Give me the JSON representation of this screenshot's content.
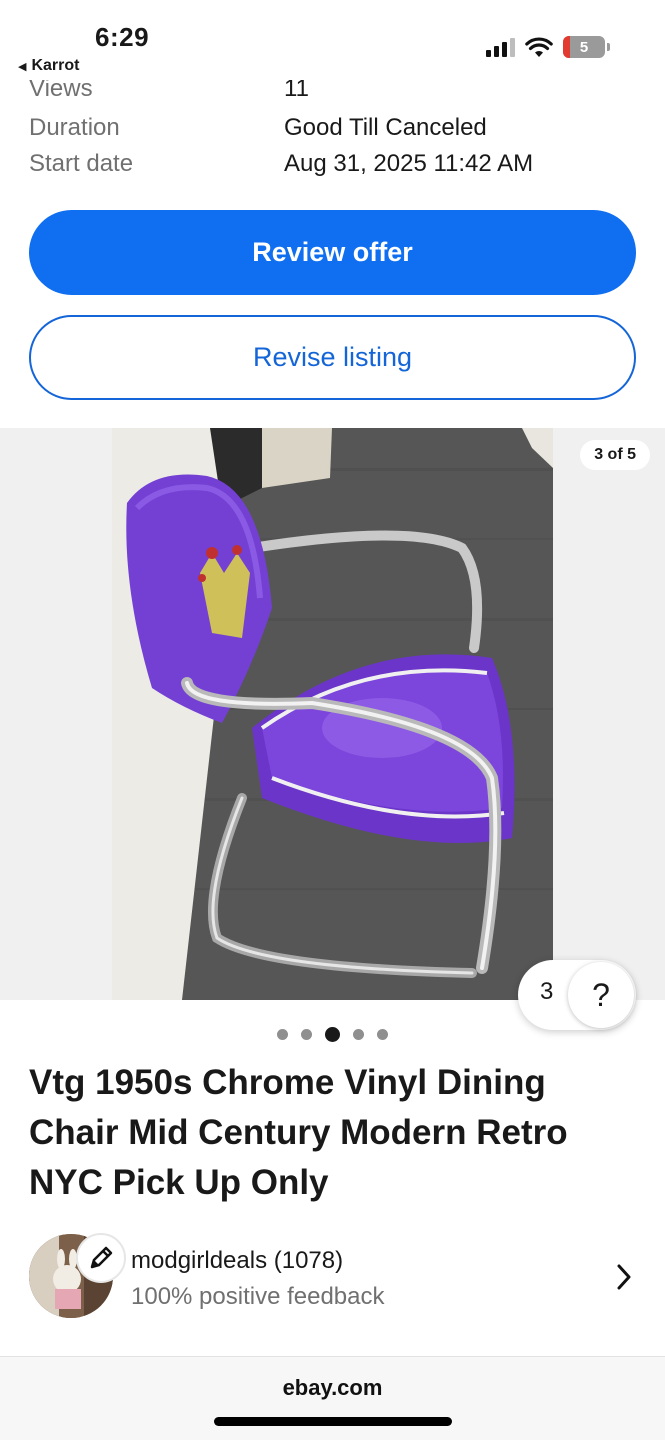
{
  "status_bar": {
    "time": "6:29",
    "back_app": "Karrot",
    "battery_level": "5"
  },
  "details": {
    "partial_row": {
      "label": "Views",
      "value": "11"
    },
    "rows": [
      {
        "label": "Duration",
        "value": "Good Till Canceled"
      },
      {
        "label": "Start date",
        "value": "Aug 31, 2025 11:42 AM"
      }
    ]
  },
  "actions": {
    "primary_label": "Review offer",
    "secondary_label": "Revise listing"
  },
  "gallery": {
    "counter": "3 of 5",
    "image_count": 5,
    "active_index": 3
  },
  "help": {
    "count": "3",
    "icon_label": "?"
  },
  "listing": {
    "title": "Vtg 1950s Chrome Vinyl Dining Chair Mid Century Modern Retro NYC Pick Up Only"
  },
  "seller": {
    "name": "modgirldeals (1078)",
    "feedback": "100% positive feedback"
  },
  "browser": {
    "url": "ebay.com"
  },
  "colors": {
    "primary": "#0f6ff0",
    "secondary_border": "#1465d8",
    "text_muted": "#707070"
  }
}
